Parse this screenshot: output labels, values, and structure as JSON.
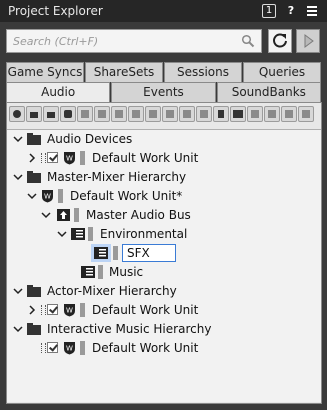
{
  "window": {
    "title": "Project Explorer",
    "count_badge": "1",
    "help_label": "?"
  },
  "search": {
    "placeholder": "Search (Ctrl+F)"
  },
  "tabs_row1": [
    "Game Syncs",
    "ShareSets",
    "Sessions",
    "Queries"
  ],
  "tabs_row2": [
    "Audio",
    "Events",
    "SoundBanks"
  ],
  "active_tab": "Audio",
  "tree": {
    "audio_devices": "Audio Devices",
    "ad_default_work_unit": "Default Work Unit",
    "master_mixer_hierarchy": "Master-Mixer Hierarchy",
    "mm_default_work_unit": "Default Work Unit*",
    "master_audio_bus": "Master Audio Bus",
    "environmental": "Environmental",
    "sfx_edit_value": "SFX",
    "music": "Music",
    "actor_mixer_hierarchy": "Actor-Mixer Hierarchy",
    "am_default_work_unit": "Default Work Unit",
    "interactive_music_hierarchy": "Interactive Music Hierarchy",
    "im_default_work_unit": "Default Work Unit"
  },
  "colors": {
    "titlebar": "#262626",
    "panel": "#e8e8e8",
    "selection": "#3a7bd5"
  }
}
